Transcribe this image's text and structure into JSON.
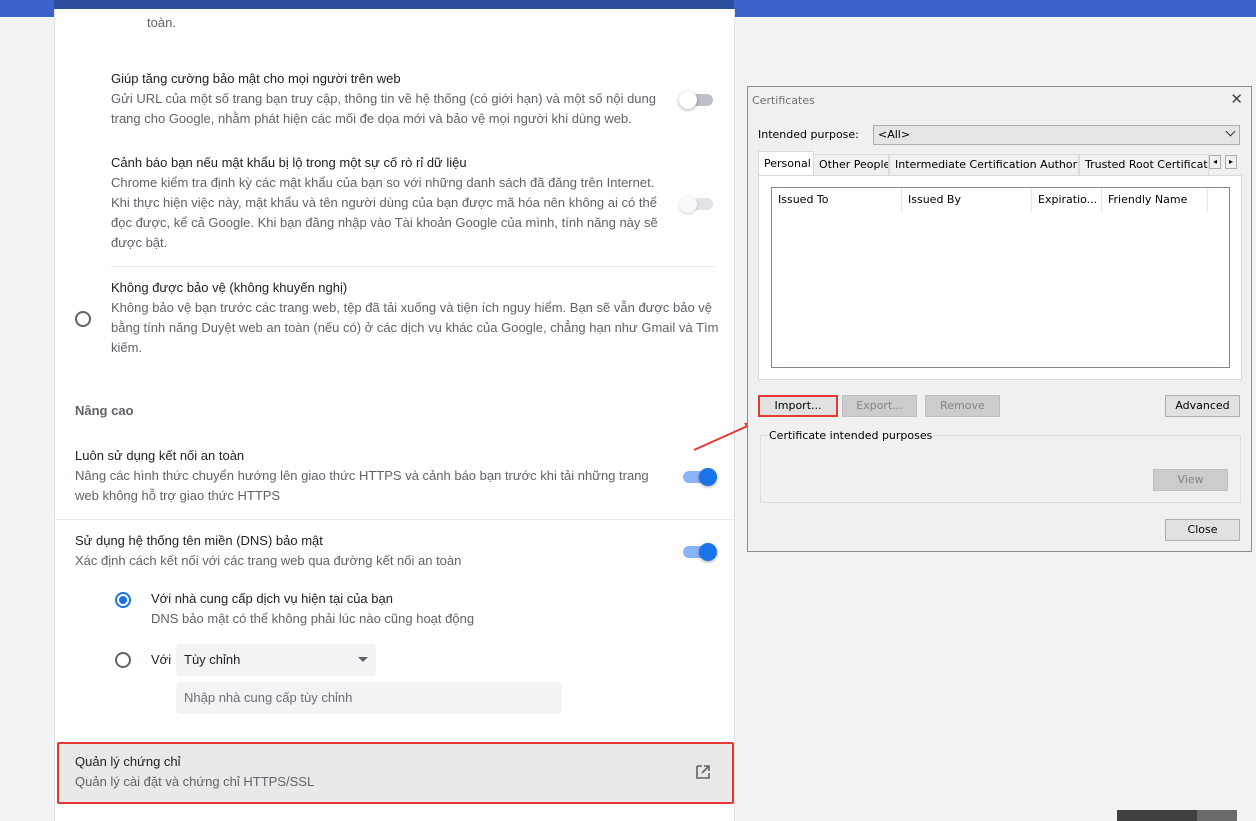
{
  "settings": {
    "prev_tail": "toàn.",
    "safe_browsing_help": {
      "title": "Giúp tăng cường bảo mật cho mọi người trên web",
      "desc1": "Gửi URL của một số trang bạn truy cập, thông tin về hệ thống (có giới hạn) và một số nội dung",
      "desc2": "trang cho Google, nhằm phát hiện các mối đe dọa mới và bảo vệ mọi người khi dùng web."
    },
    "password_leak": {
      "title": "Cảnh báo bạn nếu mật khẩu bị lộ trong một sự cố rò rỉ dữ liệu",
      "desc1": "Chrome kiểm tra định kỳ các mật khẩu của bạn so với những danh sách đã đăng trên Internet.",
      "desc2": "Khi thực hiện việc này, mật khẩu và tên người dùng của bạn được mã hóa nên không ai có thể",
      "desc3": "đọc được, kể cả Google. Khi bạn đăng nhập vào Tài khoản Google của mình, tính năng này sẽ",
      "desc4": "được bật."
    },
    "no_protection": {
      "title": "Không được bảo vệ (không khuyến nghị)",
      "desc1": "Không bảo vệ bạn trước các trang web, tệp đã tải xuống và tiện ích nguy hiểm. Bạn sẽ vẫn được bảo vệ",
      "desc2": "bằng tính năng Duyệt web an toàn (nếu có) ở các dịch vụ khác của Google, chẳng hạn như Gmail và Tìm",
      "desc3": "kiếm."
    },
    "advanced_heading": "Nâng cao",
    "https_always": {
      "title": "Luôn sử dụng kết nối an toàn",
      "desc1": "Nâng các hình thức chuyển hướng lên giao thức HTTPS và cảnh báo bạn trước khi tải những trang",
      "desc2": "web không hỗ trợ giao thức HTTPS"
    },
    "secure_dns": {
      "title": "Sử dụng hệ thống tên miền (DNS) bảo mật",
      "desc": "Xác định cách kết nối với các trang web qua đường kết nối an toàn",
      "option_current": "Với nhà cung cấp dịch vụ hiện tại của bạn",
      "option_current_desc": "DNS bảo mật có thể không phải lúc nào cũng hoạt động",
      "option_with": "Với",
      "select_value": "Tùy chỉnh",
      "custom_placeholder": "Nhập nhà cung cấp tùy chỉnh"
    },
    "manage_certs": {
      "title": "Quản lý chứng chỉ",
      "desc": "Quản lý cài đặt và chứng chỉ HTTPS/SSL"
    }
  },
  "dialog": {
    "title": "Certificates",
    "close_glyph": "✕",
    "intended_purpose_label": "Intended purpose:",
    "intended_purpose_value": "<All>",
    "tabs": [
      "Personal",
      "Other People",
      "Intermediate Certification Authorities",
      "Trusted Root Certification"
    ],
    "scroll_left": "◂",
    "scroll_right": "▸",
    "columns": [
      "Issued To",
      "Issued By",
      "Expiratio...",
      "Friendly Name"
    ],
    "buttons": {
      "import": "Import...",
      "export": "Export...",
      "remove": "Remove",
      "advanced": "Advanced",
      "view": "View",
      "close": "Close"
    },
    "purposes_group_label": "Certificate intended purposes"
  },
  "colors": {
    "accent": "#1a73e8",
    "highlight": "#e53935",
    "topbar": "#3c63c9"
  }
}
